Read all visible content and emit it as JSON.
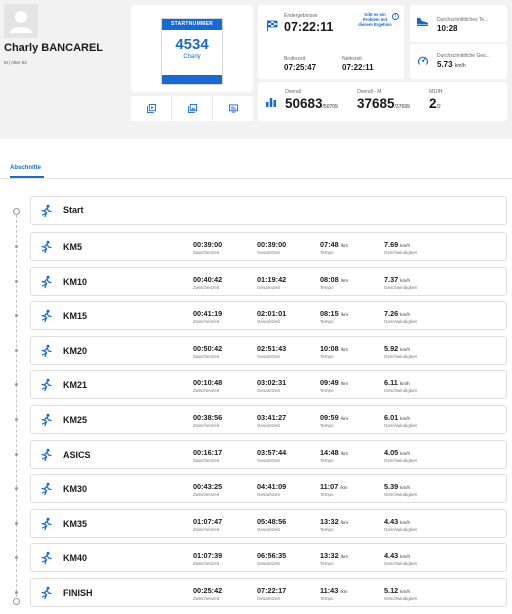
{
  "runner": {
    "name": "Charly BANCAREL",
    "meta": "M | Alter 93"
  },
  "bib": {
    "header": "STARTNUMMER",
    "number": "4534",
    "first_name": "Charly"
  },
  "actions": [
    {
      "icon": "photo-gallery-icon"
    },
    {
      "icon": "certificate-icon"
    },
    {
      "icon": "share-screen-icon"
    }
  ],
  "result": {
    "final_label": "Endergebnisse",
    "final_time": "07:22:11",
    "problem_link": "Gibt es ein Problem mit diesem Ergebnis",
    "gross_label": "Bruttozeit",
    "gross_time": "07:25:47",
    "net_label": "Nettozeit",
    "net_time": "07:22:11"
  },
  "tempo": {
    "label": "Durchschnittliches Te...",
    "value": "10:28"
  },
  "speed": {
    "label": "Durchschnittliche Ges...",
    "value": "5.73",
    "unit": "km/h"
  },
  "overall": {
    "overall_label": "Overall",
    "overall_rank": "50683",
    "overall_total": "/50709",
    "gender_label": "Overall - M",
    "gender_rank": "37685",
    "gender_total": "/37699",
    "age_label": "M10H",
    "age_rank": "2",
    "age_total": "/2"
  },
  "tabs": {
    "active": "Abschnitte"
  },
  "labels": {
    "split": "Zwischenzeit",
    "total": "Gesamtzeit",
    "pace": "Tempo",
    "speed": "Geschwindigkeit",
    "pace_unit": "/km",
    "speed_unit": "km/h"
  },
  "start_label": "Start",
  "colors": {
    "accent": "#1769d6",
    "background": "#f2f2f2"
  },
  "splits": [
    {
      "name": "KM5",
      "split": "00:39:00",
      "total": "00:39:00",
      "pace": "07:48",
      "speed": "7.69"
    },
    {
      "name": "KM10",
      "split": "00:40:42",
      "total": "01:19:42",
      "pace": "08:08",
      "speed": "7.37"
    },
    {
      "name": "KM15",
      "split": "00:41:19",
      "total": "02:01:01",
      "pace": "08:15",
      "speed": "7.26"
    },
    {
      "name": "KM20",
      "split": "00:50:42",
      "total": "02:51:43",
      "pace": "10:08",
      "speed": "5.92"
    },
    {
      "name": "KM21",
      "split": "00:10:48",
      "total": "03:02:31",
      "pace": "09:49",
      "speed": "6.11"
    },
    {
      "name": "KM25",
      "split": "00:38:56",
      "total": "03:41:27",
      "pace": "09:59",
      "speed": "6.01"
    },
    {
      "name": "ASICS",
      "split": "00:16:17",
      "total": "03:57:44",
      "pace": "14:48",
      "speed": "4.05"
    },
    {
      "name": "KM30",
      "split": "00:43:25",
      "total": "04:41:09",
      "pace": "11:07",
      "speed": "5.39"
    },
    {
      "name": "KM35",
      "split": "01:07:47",
      "total": "05:48:56",
      "pace": "13:32",
      "speed": "4.43"
    },
    {
      "name": "KM40",
      "split": "01:07:39",
      "total": "06:56:35",
      "pace": "13:32",
      "speed": "4.43"
    },
    {
      "name": "FINISH",
      "split": "00:25:42",
      "total": "07:22:17",
      "pace": "11:43",
      "speed": "5.12"
    }
  ]
}
